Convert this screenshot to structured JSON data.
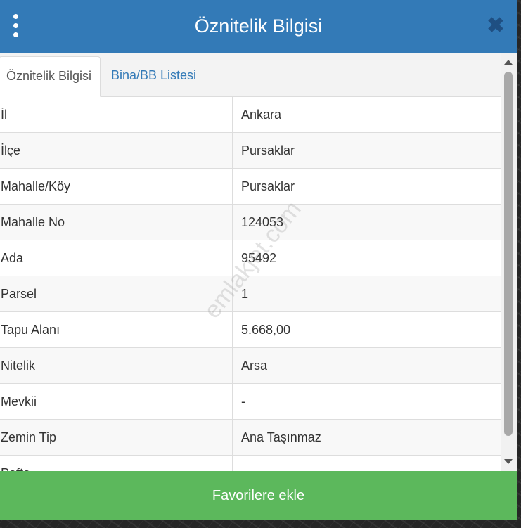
{
  "header": {
    "title": "Öznitelik Bilgisi",
    "close_glyph": "✖"
  },
  "tabs": [
    {
      "label": "Öznitelik Bilgisi",
      "active": true
    },
    {
      "label": "Bina/BB Listesi",
      "active": false
    }
  ],
  "rows": [
    {
      "key": "İl",
      "value": "Ankara"
    },
    {
      "key": "İlçe",
      "value": "Pursaklar"
    },
    {
      "key": "Mahalle/Köy",
      "value": "Pursaklar"
    },
    {
      "key": "Mahalle No",
      "value": "124053"
    },
    {
      "key": "Ada",
      "value": "95492"
    },
    {
      "key": "Parsel",
      "value": "1"
    },
    {
      "key": "Tapu Alanı",
      "value": "5.668,00"
    },
    {
      "key": "Nitelik",
      "value": "Arsa"
    },
    {
      "key": "Mevkii",
      "value": "-"
    },
    {
      "key": "Zemin Tip",
      "value": "Ana Taşınmaz"
    },
    {
      "key": "Pafta",
      "value": ""
    }
  ],
  "watermark": "emlakjet.com",
  "footer": {
    "favorite_label": "Favorilere ekle"
  },
  "colors": {
    "header": "#337ab7",
    "favorite_button": "#5cb85c",
    "tab_link": "#337ab7"
  }
}
